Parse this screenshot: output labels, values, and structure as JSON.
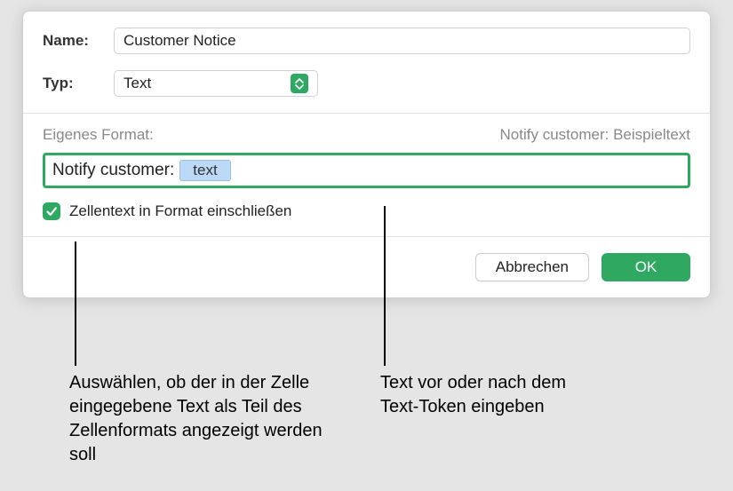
{
  "labels": {
    "name": "Name:",
    "typ": "Typ:",
    "eigenes_format": "Eigenes Format:",
    "checkbox": "Zellentext in Format einschließen"
  },
  "fields": {
    "name_value": "Customer Notice",
    "typ_value": "Text",
    "sample_label": "Notify customer: Beispieltext",
    "format_prefix": "Notify customer: ",
    "token_text": "text"
  },
  "buttons": {
    "cancel": "Abbrechen",
    "ok": "OK"
  },
  "callouts": {
    "left": "Auswählen, ob der in der Zelle eingegebene Text als Teil des Zellenformats angezeigt werden soll",
    "right": "Text vor oder nach dem Text-Token eingeben"
  }
}
